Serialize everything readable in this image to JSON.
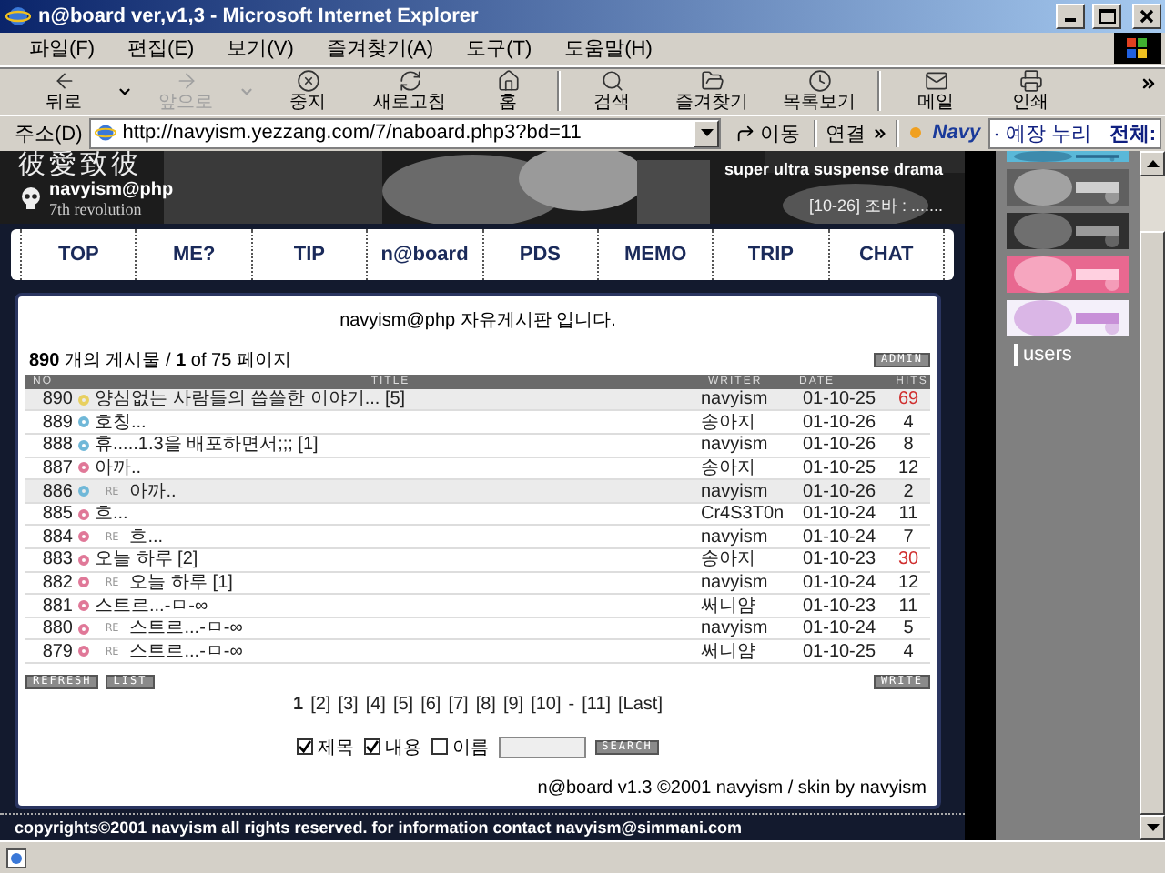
{
  "window": {
    "title": "n@board ver,v1,3 - Microsoft Internet Explorer"
  },
  "menu": [
    "파일(F)",
    "편집(E)",
    "보기(V)",
    "즐겨찾기(A)",
    "도구(T)",
    "도움말(H)"
  ],
  "toolbar": {
    "groups": [
      [
        {
          "kind": "back",
          "label": "뒤로",
          "disabled": false,
          "caret": true
        },
        {
          "kind": "forward",
          "label": "앞으로",
          "disabled": true,
          "caret": true
        },
        {
          "kind": "stop",
          "label": "중지",
          "disabled": false,
          "caret": false
        },
        {
          "kind": "refresh",
          "label": "새로고침",
          "disabled": false,
          "caret": false
        },
        {
          "kind": "home",
          "label": "홈",
          "disabled": false,
          "caret": false
        }
      ],
      [
        {
          "kind": "search",
          "label": "검색",
          "disabled": false,
          "caret": false
        },
        {
          "kind": "favorites",
          "label": "즐겨찾기",
          "disabled": false,
          "caret": false
        },
        {
          "kind": "history",
          "label": "목록보기",
          "disabled": false,
          "caret": false
        }
      ],
      [
        {
          "kind": "mail",
          "label": "메일",
          "disabled": false,
          "caret": false
        },
        {
          "kind": "print",
          "label": "인쇄",
          "disabled": false,
          "caret": false
        }
      ]
    ]
  },
  "address": {
    "label": "주소(D)",
    "url": "http://navyism.yezzang.com/7/naboard.php3?bd=11",
    "go": "이동",
    "links": "연결",
    "brand": "Navy",
    "search_value": "· 예장 누리",
    "search_label": "전체:"
  },
  "header": {
    "title": "彼愛致彼",
    "name": "navyism@php",
    "subtitle": "7th revolution",
    "tagline": "super ultra suspense drama",
    "counter": "[10-26] 조바 : ......."
  },
  "nav": [
    "TOP",
    "ME?",
    "TIP",
    "n@board",
    "PDS",
    "MEMO",
    "TRIP",
    "CHAT"
  ],
  "board": {
    "title": "navyism@php 자유게시판 입니다.",
    "summary": "**890** 개의 게시물 / **1** of 75 페이지",
    "admin": {
      "label": "ADMIN"
    },
    "columns": [
      "NO",
      "TITLE",
      "WRITER",
      "DATE",
      "HITS"
    ],
    "rows": [
      {
        "no": "890",
        "color": "#e8d060",
        "title": "양심없는 사람들의 씁쓸한 이야기... [5]",
        "writer": "navyism",
        "date": "01-10-25",
        "hits": "69",
        "hot": true,
        "highlighted": true
      },
      {
        "no": "889",
        "color": "#70b8d8",
        "title": "호칭...",
        "writer": "송아지",
        "date": "01-10-26",
        "hits": "4",
        "hot": false,
        "highlighted": false
      },
      {
        "no": "888",
        "color": "#70b8d8",
        "title": "휴.....1.3을 배포하면서;;; [1]",
        "writer": "navyism",
        "date": "01-10-26",
        "hits": "8",
        "hot": false,
        "highlighted": false
      },
      {
        "no": "887",
        "color": "#e07898",
        "title": "아까..",
        "writer": "송아지",
        "date": "01-10-25",
        "hits": "12",
        "hot": false,
        "highlighted": false
      },
      {
        "no": "886",
        "color": "#70b8d8",
        "reply_mark": "RE",
        "title": "아까..",
        "writer": "navyism",
        "date": "01-10-26",
        "hits": "2",
        "hot": false,
        "highlighted": true
      },
      {
        "no": "885",
        "color": "#e07898",
        "title": "흐...",
        "writer": "Cr4S3T0n",
        "date": "01-10-24",
        "hits": "11",
        "hot": false,
        "highlighted": false
      },
      {
        "no": "884",
        "color": "#e07898",
        "reply_mark": "RE",
        "title": "흐...",
        "writer": "navyism",
        "date": "01-10-24",
        "hits": "7",
        "hot": false,
        "highlighted": false
      },
      {
        "no": "883",
        "color": "#e07898",
        "title": "오늘 하루 [2]",
        "writer": "송아지",
        "date": "01-10-23",
        "hits": "30",
        "hot": true,
        "highlighted": false
      },
      {
        "no": "882",
        "color": "#e07898",
        "reply_mark": "RE",
        "title": "오늘 하루 [1]",
        "writer": "navyism",
        "date": "01-10-24",
        "hits": "12",
        "hot": false,
        "highlighted": false
      },
      {
        "no": "881",
        "color": "#e07898",
        "title": "스트르...-ㅁ-∞",
        "writer": "써니얌",
        "date": "01-10-23",
        "hits": "11",
        "hot": false,
        "highlighted": false
      },
      {
        "no": "880",
        "color": "#e07898",
        "reply_mark": "RE",
        "title": "스트르...-ㅁ-∞",
        "writer": "navyism",
        "date": "01-10-24",
        "hits": "5",
        "hot": false,
        "highlighted": false
      },
      {
        "no": "879",
        "color": "#e07898",
        "reply_mark": "RE",
        "title": "스트르...-ㅁ-∞",
        "writer": "써니얌",
        "date": "01-10-25",
        "hits": "4",
        "hot": false,
        "highlighted": false
      }
    ],
    "left_buttons": [
      "REFRESH",
      "LIST"
    ],
    "right_buttons": [
      "WRITE"
    ],
    "pages": [
      {
        "label": "1",
        "selected": true
      },
      {
        "label": "[2]",
        "selected": false
      },
      {
        "label": "[3]",
        "selected": false
      },
      {
        "label": "[4]",
        "selected": false
      },
      {
        "label": "[5]",
        "selected": false
      },
      {
        "label": "[6]",
        "selected": false
      },
      {
        "label": "[7]",
        "selected": false
      },
      {
        "label": "[8]",
        "selected": false
      },
      {
        "label": "[9]",
        "selected": false
      },
      {
        "label": "[10]",
        "selected": false
      },
      {
        "label": "-",
        "selected": false
      },
      {
        "label": "[11]",
        "selected": false
      },
      {
        "label": "[Last]",
        "selected": false
      }
    ],
    "search": {
      "options": [
        {
          "label": "제목",
          "checked": true
        },
        {
          "label": "내용",
          "checked": true
        },
        {
          "label": "이름",
          "checked": false
        }
      ],
      "button": "SEARCH"
    },
    "credit": "n@board v1.3 ©2001 navyism / skin by navyism"
  },
  "footer": "copyrights©2001 navyism all rights reserved. for information contact navyism@simmani.com",
  "sidebar": {
    "users": "users"
  }
}
